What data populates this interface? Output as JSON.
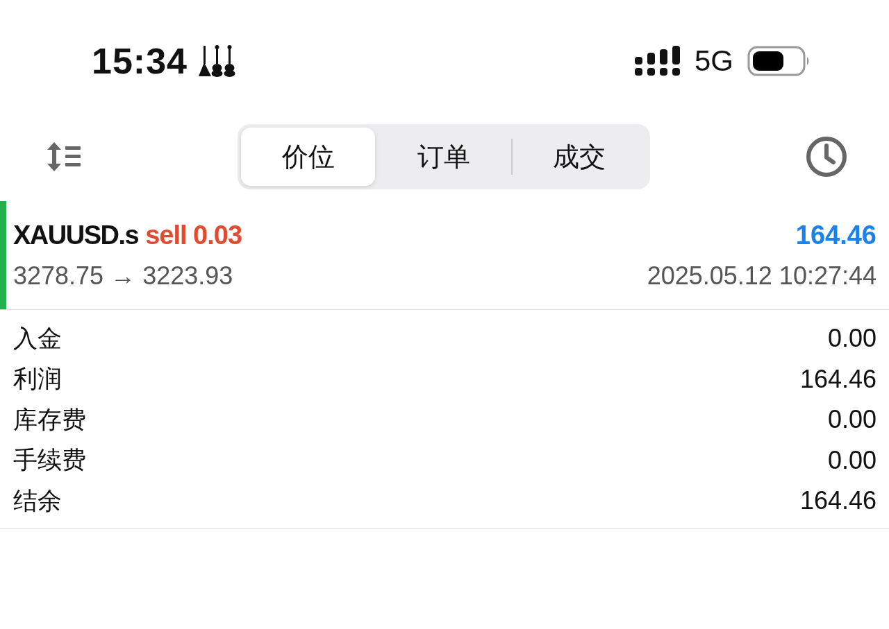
{
  "status_bar": {
    "time": "15:34",
    "network": "5G"
  },
  "toolbar": {
    "tabs": [
      {
        "label": "价位",
        "selected": true
      },
      {
        "label": "订单",
        "selected": false
      },
      {
        "label": "成交",
        "selected": false
      }
    ]
  },
  "deals": [
    {
      "symbol": "XAUUSD.s",
      "side": "sell 0.03",
      "profit": "164.46",
      "prices": "3278.75 → 3223.93",
      "time": "2025.05.12 10:27:44",
      "color": "#22b14c"
    }
  ],
  "summary": [
    {
      "label": "入金",
      "value": "0.00"
    },
    {
      "label": "利润",
      "value": "164.46"
    },
    {
      "label": "库存费",
      "value": "0.00"
    },
    {
      "label": "手续费",
      "value": "0.00"
    },
    {
      "label": "结余",
      "value": "164.46"
    }
  ]
}
